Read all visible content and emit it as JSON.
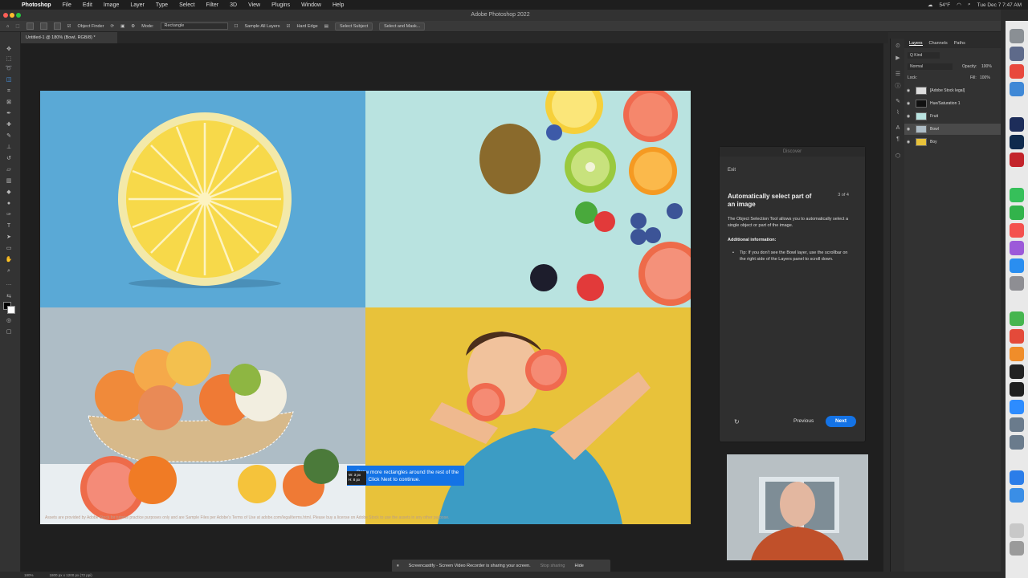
{
  "menubar": {
    "apple": "",
    "items": [
      "Photoshop",
      "File",
      "Edit",
      "Image",
      "Layer",
      "Type",
      "Select",
      "Filter",
      "3D",
      "View",
      "Plugins",
      "Window",
      "Help"
    ],
    "app_title": "Adobe Photoshop 2022",
    "weather": "54°F",
    "clock": "Tue Dec 7  7:47 AM"
  },
  "options_bar": {
    "object_finder": "Object Finder",
    "mode_label": "Mode:",
    "mode_value": "Rectangle",
    "sample_all_layers": "Sample All Layers",
    "hard_edge": "Hard Edge",
    "select_subject": "Select Subject",
    "select_and_mask": "Select and Mask..."
  },
  "document": {
    "tab_title": "Untitled-1 @ 180% (Bowl, RGB/8) *",
    "footer_note": "Assets are provided by Adobe Stock for tutorial practice purposes only and are Sample Files per Adobe's Terms of Use at adobe.com/legal/terms.html. Please buy a license on Adobe Stock to use the assets in any other purpose."
  },
  "coach_tip": {
    "text": "Draw more rectangles around the rest of the fruit. Click Next to continue.",
    "size_w": "W: 3 px",
    "size_h": "H: 8 px"
  },
  "layers_panel": {
    "tabs": [
      "Layers",
      "Channels",
      "Paths"
    ],
    "kind": "Q Kind",
    "blend_mode": "Normal",
    "opacity_label": "Opacity:",
    "opacity_value": "100%",
    "lock_label": "Lock:",
    "fill_label": "Fill:",
    "fill_value": "100%",
    "layers": [
      {
        "name": "[Adobe Stock legal]"
      },
      {
        "name": "Hue/Saturation 1"
      },
      {
        "name": "Fruit"
      },
      {
        "name": "Bowl",
        "selected": true
      },
      {
        "name": "Boy"
      }
    ]
  },
  "discover": {
    "header": "Discover",
    "exit": "Exit",
    "heading": "Automatically select part of an image",
    "step": "3 of 4",
    "body": "The Object Selection Tool allows you to automatically select a single object or part of the image.",
    "additional": "Additional information:",
    "tip": "Tip: If you don't see the Bowl layer, use the scrollbar on the right side of the Layers panel to scroll down.",
    "previous": "Previous",
    "next": "Next"
  },
  "statusbar": {
    "zoom": "180%",
    "dimensions": "1800 px x 1200 px (72 ppi)"
  },
  "share_bar": {
    "message": "Screencastify - Screen Video Recorder is sharing your screen.",
    "stop": "Stop sharing",
    "hide": "Hide"
  },
  "colors": {
    "accent": "#1473e6",
    "lemon_bg": "#5aa9d6",
    "fruit_bg": "#b9e3e0",
    "bowl_bg": "#aebdc6",
    "boy_bg": "#e8c23a"
  }
}
